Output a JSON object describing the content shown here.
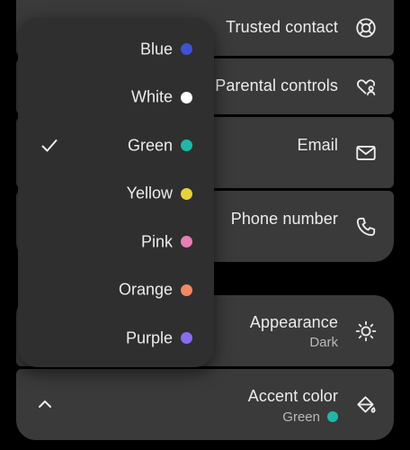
{
  "settings": {
    "trusted_contact": {
      "label": "Trusted contact",
      "icon": "lifebuoy-icon"
    },
    "parental_controls": {
      "label": "Parental controls",
      "icon": "heart-person-icon"
    },
    "email": {
      "label": "Email",
      "icon": "envelope-icon"
    },
    "phone_number": {
      "label": "Phone number",
      "icon": "phone-icon"
    },
    "appearance": {
      "label": "Appearance",
      "value": "Dark",
      "icon": "sun-icon"
    },
    "accent_color": {
      "label": "Accent color",
      "value": "Green",
      "value_color": "#1fb8a8",
      "icon": "paint-bucket-icon"
    }
  },
  "accent_menu": {
    "selected": "Green",
    "items": [
      {
        "label": "Blue",
        "color": "#3f51d4"
      },
      {
        "label": "White",
        "color": "#ffffff"
      },
      {
        "label": "Green",
        "color": "#1fb8a8"
      },
      {
        "label": "Yellow",
        "color": "#e6d33a"
      },
      {
        "label": "Pink",
        "color": "#e67fb4"
      },
      {
        "label": "Orange",
        "color": "#ef8a62"
      },
      {
        "label": "Purple",
        "color": "#8b6cf0"
      }
    ]
  },
  "colors": {
    "background": "#000000",
    "card": "#3a3a3a",
    "menu": "#2f2f2f",
    "text": "#ececec",
    "subtext": "#b9b9b9"
  }
}
